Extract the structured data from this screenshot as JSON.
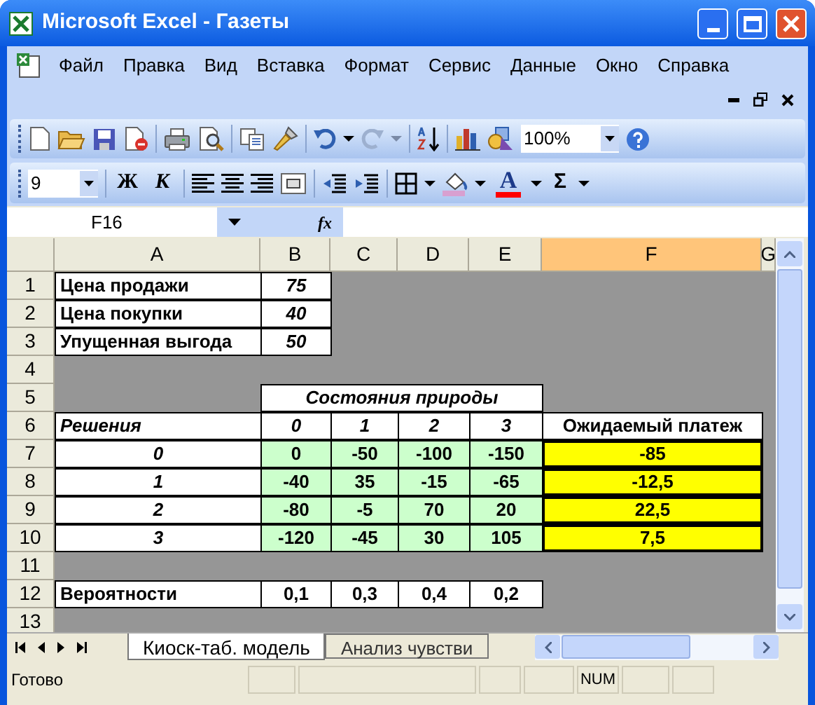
{
  "window": {
    "title": "Microsoft Excel - Газеты"
  },
  "menu": [
    "Файл",
    "Правка",
    "Вид",
    "Вставка",
    "Формат",
    "Сервис",
    "Данные",
    "Окно",
    "Справка"
  ],
  "standard_toolbar": {
    "zoom": "100%"
  },
  "formatting_toolbar": {
    "font_size": "9",
    "bold": "Ж",
    "italic": "К",
    "font_color": "A",
    "sum": "Σ"
  },
  "formula_bar": {
    "name_box": "F16",
    "fx": "fx"
  },
  "columns": [
    {
      "label": "A",
      "selected": false
    },
    {
      "label": "B",
      "selected": false
    },
    {
      "label": "C",
      "selected": false
    },
    {
      "label": "D",
      "selected": false
    },
    {
      "label": "E",
      "selected": false
    },
    {
      "label": "F",
      "selected": true
    },
    {
      "label": "G",
      "selected": false
    }
  ],
  "rows": [
    {
      "number": "1",
      "cells": [
        {
          "kind": "label",
          "text": "Цена продажи"
        },
        {
          "kind": "italic",
          "text": "75"
        },
        {
          "kind": "empty"
        },
        {
          "kind": "empty"
        },
        {
          "kind": "empty"
        },
        {
          "kind": "empty"
        }
      ]
    },
    {
      "number": "2",
      "cells": [
        {
          "kind": "label",
          "text": "Цена покупки"
        },
        {
          "kind": "italic",
          "text": "40"
        },
        {
          "kind": "empty"
        },
        {
          "kind": "empty"
        },
        {
          "kind": "empty"
        },
        {
          "kind": "empty"
        }
      ]
    },
    {
      "number": "3",
      "cells": [
        {
          "kind": "label",
          "text": "Упущенная выгода"
        },
        {
          "kind": "italic",
          "text": "50"
        },
        {
          "kind": "empty"
        },
        {
          "kind": "empty"
        },
        {
          "kind": "empty"
        },
        {
          "kind": "empty"
        }
      ]
    },
    {
      "number": "4",
      "cells": [
        {
          "kind": "empty"
        },
        {
          "kind": "empty"
        },
        {
          "kind": "empty"
        },
        {
          "kind": "empty"
        },
        {
          "kind": "empty"
        },
        {
          "kind": "empty"
        }
      ]
    },
    {
      "number": "5",
      "cells": [
        {
          "kind": "empty"
        },
        {
          "kind": "merged",
          "text": "Состояния природы"
        },
        {
          "kind": "empty"
        }
      ]
    },
    {
      "number": "6",
      "cells": [
        {
          "kind": "label_italic",
          "text": "Решения"
        },
        {
          "kind": "italic",
          "text": "0"
        },
        {
          "kind": "italic",
          "text": "1"
        },
        {
          "kind": "italic",
          "text": "2"
        },
        {
          "kind": "italic",
          "text": "3"
        },
        {
          "kind": "bold",
          "text": "Ожидаемый платеж"
        }
      ]
    },
    {
      "number": "7",
      "cells": [
        {
          "kind": "italic",
          "text": "0"
        },
        {
          "kind": "payoff",
          "text": "0"
        },
        {
          "kind": "payoff",
          "text": "-50"
        },
        {
          "kind": "payoff",
          "text": "-100"
        },
        {
          "kind": "payoff",
          "text": "-150"
        },
        {
          "kind": "result",
          "text": "-85"
        }
      ]
    },
    {
      "number": "8",
      "cells": [
        {
          "kind": "italic",
          "text": "1"
        },
        {
          "kind": "payoff",
          "text": "-40"
        },
        {
          "kind": "payoff",
          "text": "35"
        },
        {
          "kind": "payoff",
          "text": "-15"
        },
        {
          "kind": "payoff",
          "text": "-65"
        },
        {
          "kind": "result",
          "text": "-12,5"
        }
      ]
    },
    {
      "number": "9",
      "cells": [
        {
          "kind": "italic",
          "text": "2"
        },
        {
          "kind": "payoff",
          "text": "-80"
        },
        {
          "kind": "payoff",
          "text": "-5"
        },
        {
          "kind": "payoff",
          "text": "70"
        },
        {
          "kind": "payoff",
          "text": "20"
        },
        {
          "kind": "result",
          "text": "22,5"
        }
      ]
    },
    {
      "number": "10",
      "cells": [
        {
          "kind": "italic",
          "text": "3"
        },
        {
          "kind": "payoff",
          "text": "-120"
        },
        {
          "kind": "payoff",
          "text": "-45"
        },
        {
          "kind": "payoff",
          "text": "30"
        },
        {
          "kind": "payoff",
          "text": "105"
        },
        {
          "kind": "result",
          "text": "7,5"
        }
      ]
    },
    {
      "number": "11",
      "cells": [
        {
          "kind": "empty"
        },
        {
          "kind": "empty"
        },
        {
          "kind": "empty"
        },
        {
          "kind": "empty"
        },
        {
          "kind": "empty"
        },
        {
          "kind": "empty"
        }
      ]
    },
    {
      "number": "12",
      "cells": [
        {
          "kind": "label",
          "text": "Вероятности"
        },
        {
          "kind": "bold",
          "text": "0,1"
        },
        {
          "kind": "bold",
          "text": "0,3"
        },
        {
          "kind": "bold",
          "text": "0,4"
        },
        {
          "kind": "bold",
          "text": "0,2"
        },
        {
          "kind": "empty"
        }
      ]
    },
    {
      "number": "13",
      "cells": [
        {
          "kind": "empty"
        },
        {
          "kind": "empty"
        },
        {
          "kind": "empty"
        },
        {
          "kind": "empty"
        },
        {
          "kind": "empty"
        },
        {
          "kind": "empty"
        }
      ]
    }
  ],
  "sheet_tabs": [
    {
      "label": "Киоск-таб. модель",
      "selected": true
    },
    {
      "label": "Анализ чувстви",
      "selected": false
    }
  ],
  "status_bar": {
    "status": "Готово",
    "num": "NUM"
  }
}
